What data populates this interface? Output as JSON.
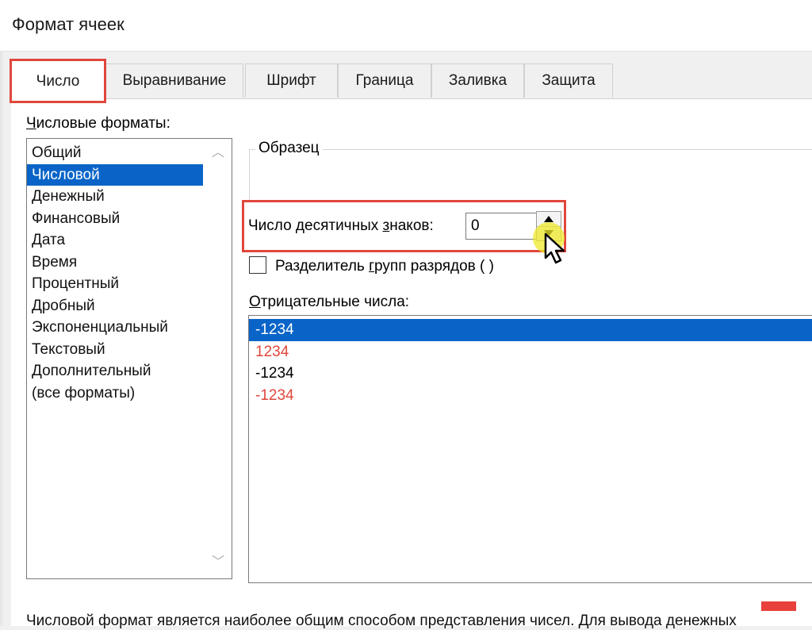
{
  "window": {
    "title": "Формат ячеек"
  },
  "tabs": [
    {
      "label": "Число",
      "active": true
    },
    {
      "label": "Выравнивание",
      "active": false
    },
    {
      "label": "Шрифт",
      "active": false
    },
    {
      "label": "Граница",
      "active": false
    },
    {
      "label": "Заливка",
      "active": false
    },
    {
      "label": "Защита",
      "active": false
    }
  ],
  "formats": {
    "label_underlined": "Ч",
    "label_rest": "исловые форматы:",
    "selected_index": 1,
    "items": [
      "Общий",
      "Числовой",
      "Денежный",
      "Финансовый",
      "Дата",
      "Время",
      "Процентный",
      "Дробный",
      "Экспоненциальный",
      "Текстовый",
      "Дополнительный",
      "(все форматы)"
    ]
  },
  "sample": {
    "title": "Образец"
  },
  "decimals": {
    "label_before": "Число десятичных ",
    "label_underlined": "з",
    "label_after": "наков:",
    "value": "0"
  },
  "separator": {
    "label_before": "Разделитель ",
    "label_underlined": "г",
    "label_after": "рупп разрядов ( )",
    "checked": false
  },
  "negative": {
    "label_underlined": "О",
    "label_rest": "трицательные числа:",
    "items": [
      {
        "text": "-1234",
        "selected": true,
        "red": false
      },
      {
        "text": "1234",
        "selected": false,
        "red": true
      },
      {
        "text": "-1234",
        "selected": false,
        "red": false
      },
      {
        "text": "-1234",
        "selected": false,
        "red": true
      }
    ]
  },
  "description": "Числовой формат является наиболее общим способом представления чисел. Для вывода денежных",
  "colors": {
    "accent_red": "#e0473c",
    "selection_blue": "#0a64c8",
    "cursor_highlight": "#eee828"
  }
}
